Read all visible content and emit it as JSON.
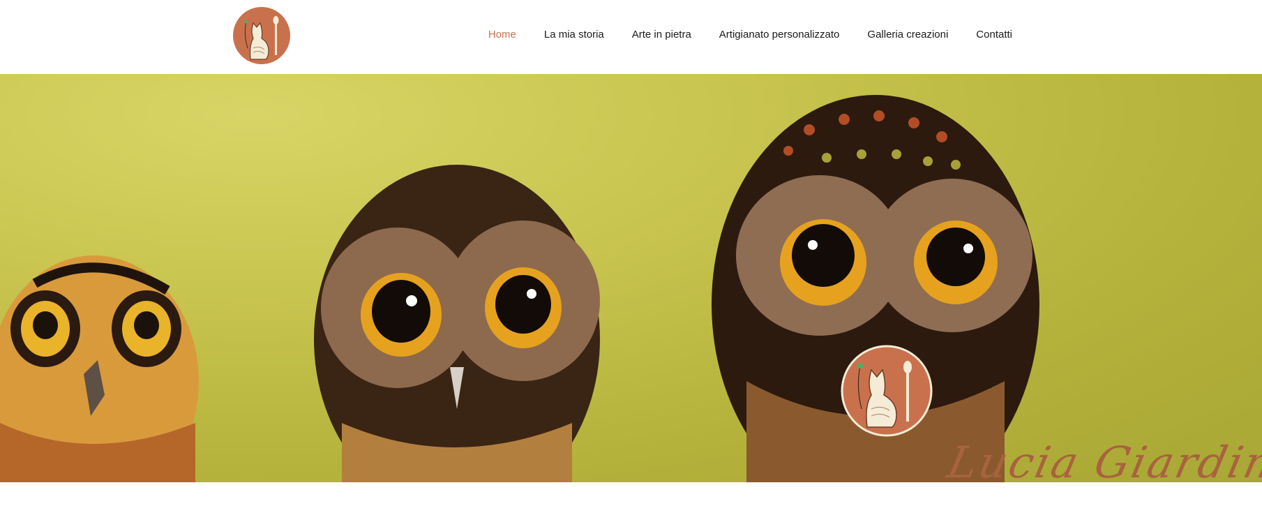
{
  "header": {
    "logo_icon": "cat-artist-logo-icon",
    "nav": [
      {
        "label": "Home",
        "active": true
      },
      {
        "label": "La mia storia",
        "active": false
      },
      {
        "label": "Arte in pietra",
        "active": false
      },
      {
        "label": "Artigianato personalizzato",
        "active": false
      },
      {
        "label": "Galleria creazioni",
        "active": false
      },
      {
        "label": "Contatti",
        "active": false
      }
    ]
  },
  "hero": {
    "signature": "Lucia Giardina",
    "badge_icon": "cat-artist-logo-icon"
  },
  "colors": {
    "accent": "#c9714d",
    "nav_text": "#1a1a1a",
    "hero_background": "#c2bf49"
  }
}
